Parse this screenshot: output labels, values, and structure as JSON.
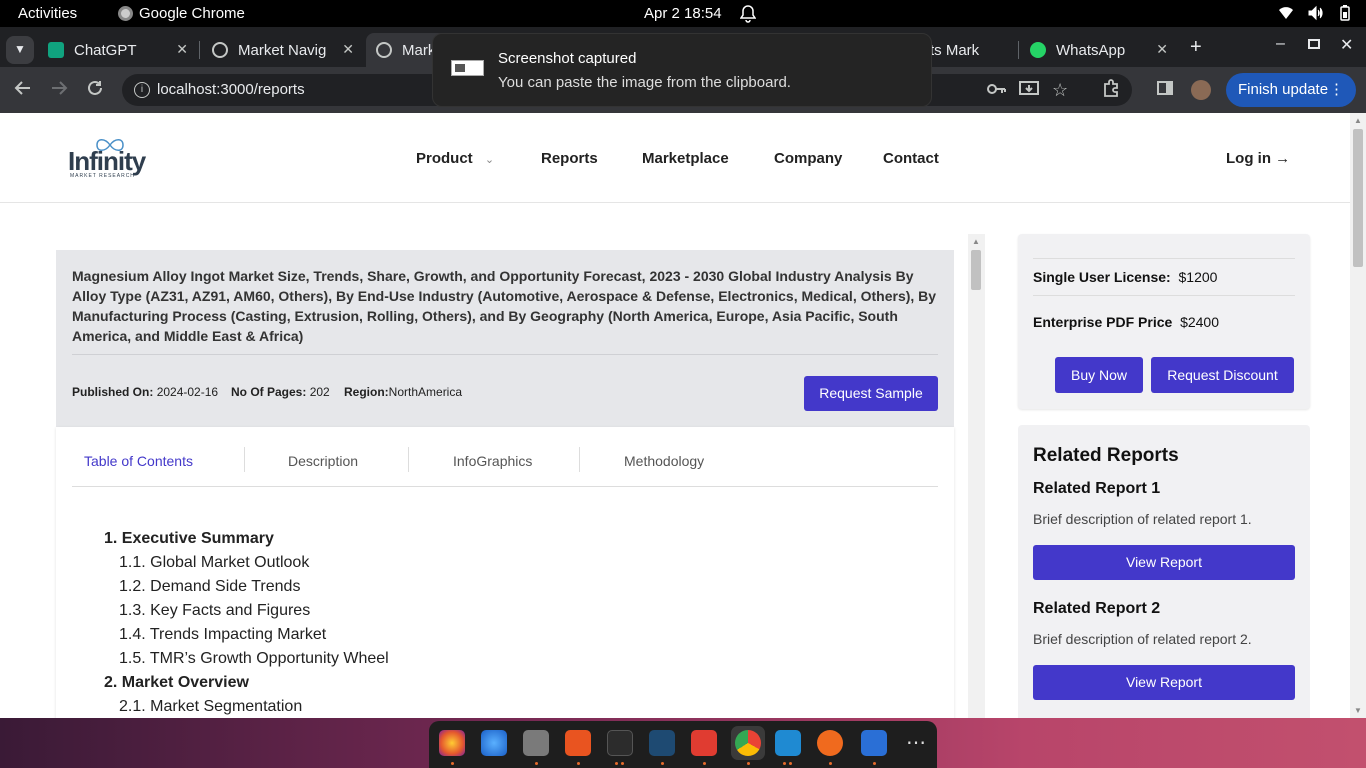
{
  "system": {
    "activities": "Activities",
    "app_name": "Google Chrome",
    "clock": "Apr 2  18:54"
  },
  "browser": {
    "tabs": [
      {
        "label": "ChatGPT"
      },
      {
        "label": "Market Navig"
      },
      {
        "label": "Mark"
      },
      {
        "label": "ts Mark"
      },
      {
        "label": "WhatsApp"
      }
    ],
    "url": "localhost:3000/reports",
    "finish_update": "Finish update"
  },
  "toast": {
    "title": "Screenshot captured",
    "message": "You can paste the image from the clipboard."
  },
  "site": {
    "logo_text": "Infinity",
    "logo_sub": "MARKET RESEARCH",
    "nav": {
      "product": "Product",
      "reports": "Reports",
      "marketplace": "Marketplace",
      "company": "Company",
      "contact": "Contact",
      "login": "Log in →"
    }
  },
  "report": {
    "title": "Magnesium Alloy Ingot Market Size, Trends, Share, Growth, and Opportunity Forecast, 2023 - 2030 Global Industry Analysis By Alloy Type (AZ31, AZ91, AM60, Others), By End-Use Industry (Automotive, Aerospace & Defense, Electronics, Medical, Others), By Manufacturing Process (Casting, Extrusion, Rolling, Others), and By Geography (North America, Europe, Asia Pacific, South America, and Middle East & Africa)",
    "published_label": "Published On:",
    "published_value": "2024-02-16",
    "pages_label": "No Of Pages:",
    "pages_value": "202",
    "region_label": "Region:",
    "region_value": "NorthAmerica",
    "request_sample": "Request Sample"
  },
  "content_tabs": {
    "toc": "Table of Contents",
    "description": "Description",
    "infographics": "InfoGraphics",
    "methodology": "Methodology"
  },
  "toc": [
    {
      "text": "1. Executive Summary",
      "level": 1
    },
    {
      "text": "1.1. Global Market Outlook",
      "level": 2
    },
    {
      "text": "1.2. Demand Side Trends",
      "level": 2
    },
    {
      "text": "1.3. Key Facts and Figures",
      "level": 2
    },
    {
      "text": "1.4. Trends Impacting Market",
      "level": 2
    },
    {
      "text": "1.5. TMR’s Growth Opportunity Wheel",
      "level": 2
    },
    {
      "text": "2. Market Overview",
      "level": 1
    },
    {
      "text": "2.1. Market Segmentation",
      "level": 2
    }
  ],
  "pricing": {
    "single_label": "Single User License:",
    "single_value": "$1200",
    "enterprise_label": "Enterprise PDF Price",
    "enterprise_value": "$2400",
    "buy_now": "Buy Now",
    "request_discount": "Request Discount"
  },
  "related": {
    "title": "Related Reports",
    "items": [
      {
        "name": "Related Report 1",
        "desc": "Brief description of related report 1.",
        "button": "View Report"
      },
      {
        "name": "Related Report 2",
        "desc": "Brief description of related report 2.",
        "button": "View Report"
      }
    ]
  },
  "colors": {
    "accent": "#4338ca",
    "header_bg": "#e6e7ea",
    "chrome_dark": "#202124"
  }
}
